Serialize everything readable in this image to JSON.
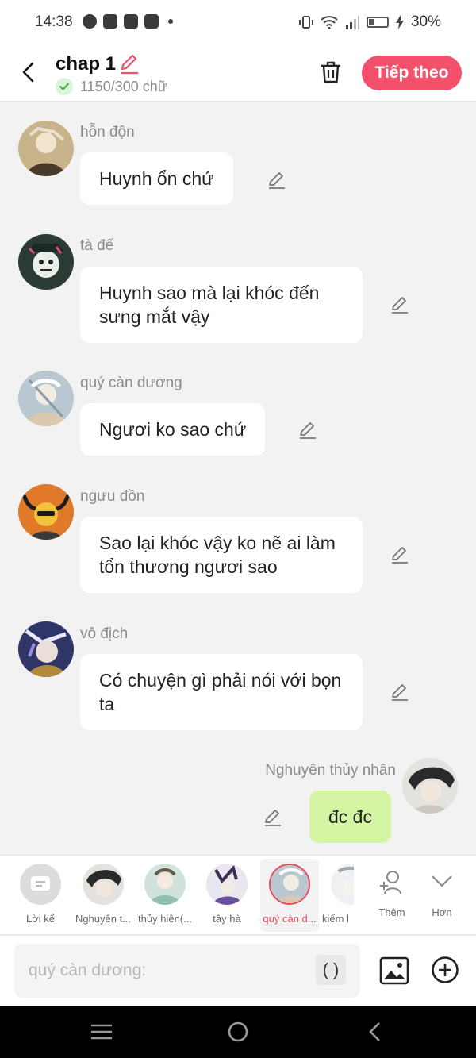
{
  "status_bar": {
    "time": "14:38",
    "battery": "30%",
    "battery_level": 0.3
  },
  "header": {
    "title": "chap 1",
    "word_count": "1150/300 chữ",
    "next_label": "Tiếp theo"
  },
  "messages": [
    {
      "sender": "hỗn độn",
      "text": "Huynh ổn chứ"
    },
    {
      "sender": "tà đế",
      "text": "Huynh sao mà lại khóc đến sưng mắt vậy"
    },
    {
      "sender": "quý càn dương",
      "text": "Ngươi ko sao chứ"
    },
    {
      "sender": "ngưu đồn",
      "text": "Sao lại khóc vậy ko nẽ ai làm tổn thương ngươi sao"
    },
    {
      "sender": "vô địch",
      "text": "Có chuyện gì phải nói với bọn ta"
    },
    {
      "sender": "Nghuyên thủy nhân",
      "text": "đc đc"
    }
  ],
  "characters": {
    "narrator": "Lời kể",
    "items": [
      "Nghuyên t...",
      "thủy hiên(...",
      "tây hà",
      "quý càn d...",
      "kiếm l"
    ],
    "selected": "quý càn d...",
    "add_label": "Thêm",
    "more_label": "Hơn"
  },
  "input": {
    "placeholder": "quý càn dương:",
    "paren_label": "( )"
  },
  "colors": {
    "accent": "#f2506b",
    "my_bubble": "#d4f5a3",
    "selected": "#e84a5f",
    "background": "#f2f2f2"
  }
}
